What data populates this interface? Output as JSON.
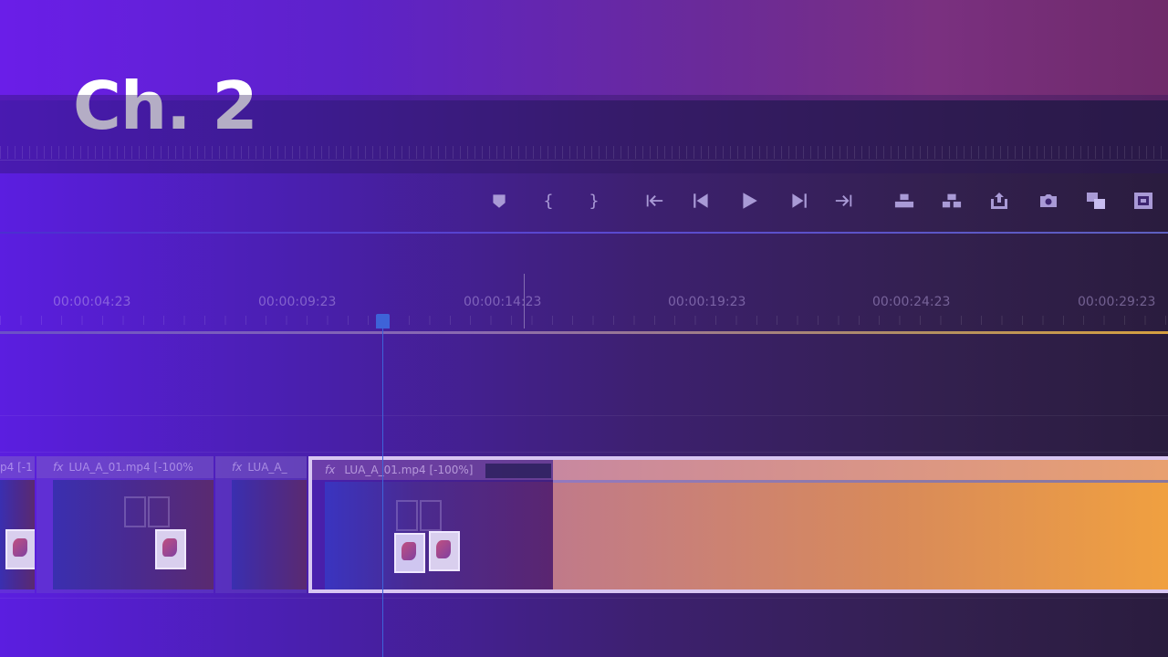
{
  "slide": {
    "title": "Ch. 2"
  },
  "toolbar": {
    "buttons": [
      {
        "name": "add-marker-icon",
        "glyph": "▼"
      },
      {
        "name": "mark-in-icon",
        "glyph": "{"
      },
      {
        "name": "mark-out-icon",
        "glyph": "}"
      },
      {
        "name": "go-to-in-icon",
        "glyph": "{←"
      },
      {
        "name": "step-back-icon",
        "glyph": "◀|"
      },
      {
        "name": "play-icon",
        "glyph": "▶"
      },
      {
        "name": "step-forward-icon",
        "glyph": "|▶"
      },
      {
        "name": "go-to-out-icon",
        "glyph": "→}"
      },
      {
        "name": "lift-icon",
        "glyph": "▦"
      },
      {
        "name": "extract-icon",
        "glyph": "▦"
      },
      {
        "name": "export-icon",
        "glyph": "⇪"
      },
      {
        "name": "camera-icon",
        "glyph": "◉"
      },
      {
        "name": "compare-icon",
        "glyph": "▣"
      },
      {
        "name": "safe-margins-icon",
        "glyph": "▩"
      }
    ]
  },
  "timeline": {
    "timecodes": [
      "00:00:04:23",
      "00:00:09:23",
      "00:00:14:23",
      "00:00:19:23",
      "00:00:24:23",
      "00:00:29:23"
    ]
  },
  "clips": [
    {
      "label": "p4 [-1",
      "fx": ""
    },
    {
      "label": "LUA_A_01.mp4 [-100%",
      "fx": "fx"
    },
    {
      "label": "LUA_A_",
      "fx": "fx"
    }
  ],
  "selected_clip": {
    "label": "LUA_A_01.mp4 [-100%]",
    "fx": "fx"
  }
}
